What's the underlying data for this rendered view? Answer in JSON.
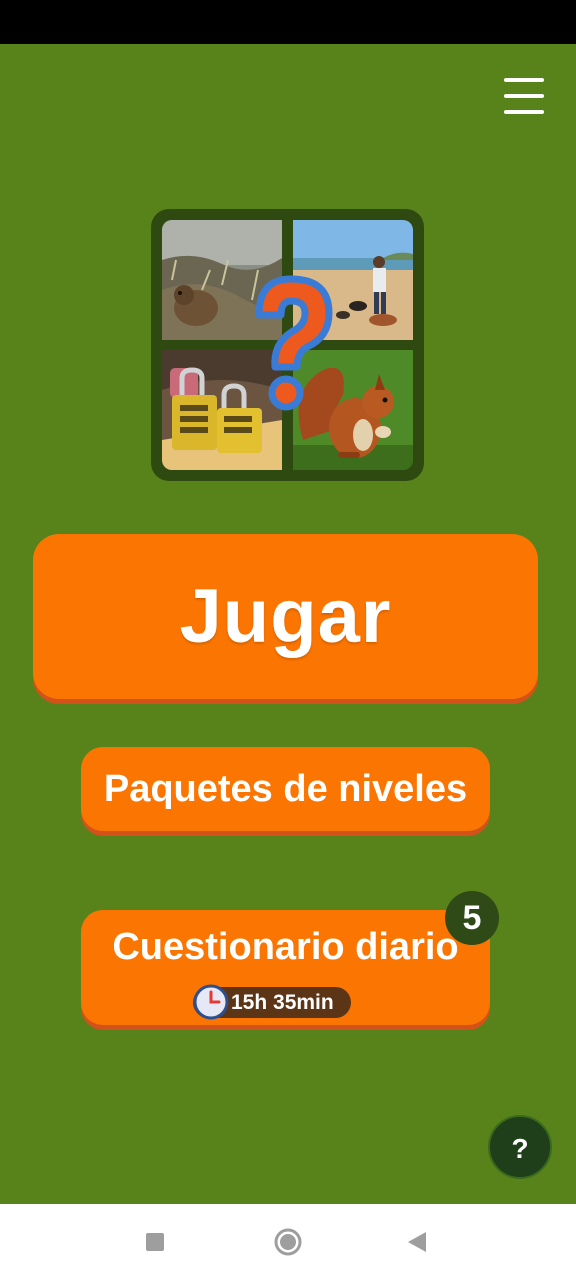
{
  "status_bar": {},
  "header": {
    "menu_icon": "hamburger-menu-icon"
  },
  "logo": {
    "images": [
      "marmot",
      "woman-walking-dogs-on-beach",
      "yellow-combination-locks",
      "red-squirrel"
    ],
    "overlay_icon": "question-mark-icon",
    "colors": {
      "frame": "#2e4a10",
      "question_fill": "#ee5a1e",
      "question_outline": "#3a7bd5"
    }
  },
  "buttons": {
    "play_label": "Jugar",
    "packs_label": "Paquetes de niveles",
    "daily_label": "Cuestionario diario",
    "daily_timer": "15h 35min",
    "daily_badge": "5"
  },
  "help": {
    "label": "?"
  },
  "colors": {
    "background": "#58821a",
    "button": "#fb7502",
    "button_shadow": "#d2521a",
    "badge": "#2f4a17"
  },
  "nav_bar": {
    "icons": [
      "recents-square-icon",
      "home-circle-icon",
      "back-triangle-icon"
    ]
  }
}
